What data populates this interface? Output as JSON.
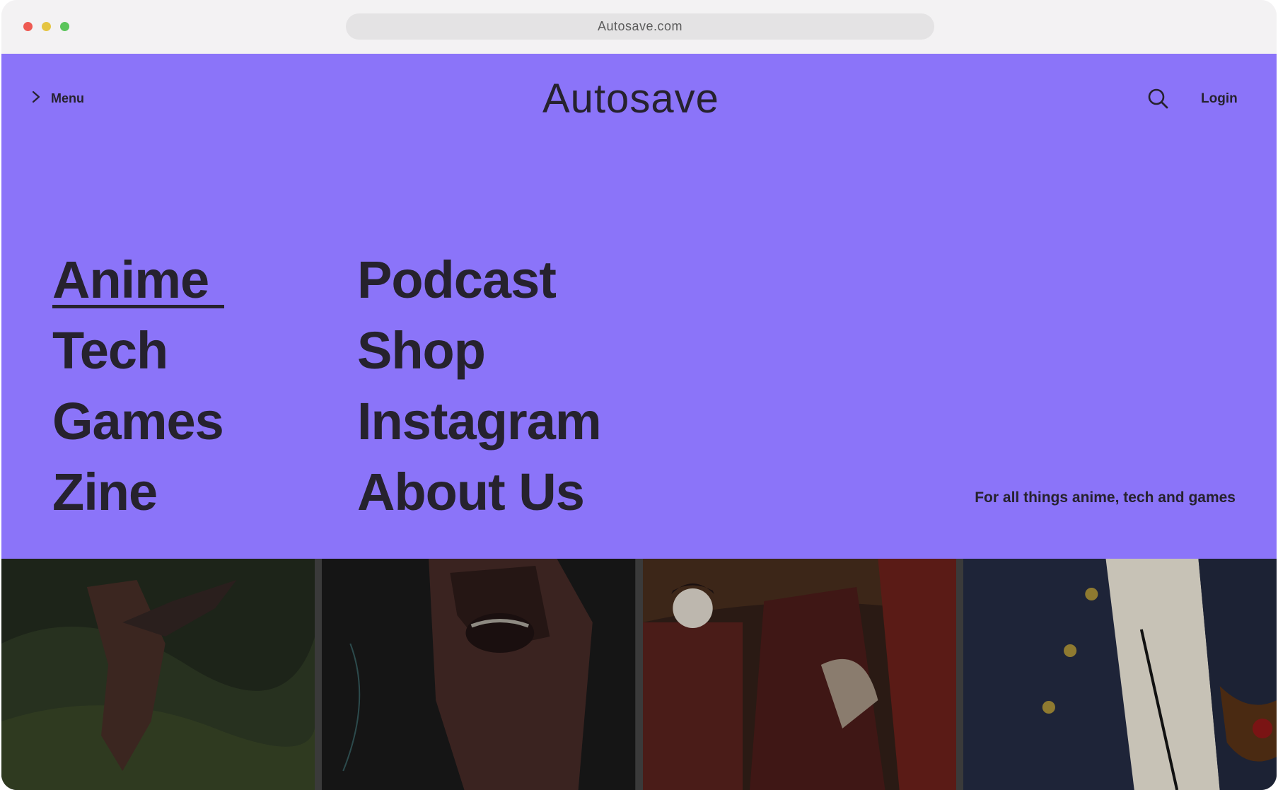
{
  "browser": {
    "url": "Autosave.com",
    "dots": [
      "#ee5a52",
      "#e5c542",
      "#5bc55b"
    ]
  },
  "colors": {
    "hero_bg": "#8b74f9",
    "text": "#26222e"
  },
  "header": {
    "menu_icon": "chevron-right-icon",
    "menu_label": "Menu",
    "logo": "Autosave",
    "search_icon": "search-icon",
    "login_label": "Login"
  },
  "nav": {
    "left": [
      "Anime",
      "Tech",
      "Games",
      "Zine"
    ],
    "right": [
      "Podcast",
      "Shop",
      "Instagram",
      "About Us"
    ],
    "active": "Anime"
  },
  "tagline": "For all things anime, tech and games",
  "gallery": {
    "panels": [
      "anime-scene-1",
      "anime-scene-2",
      "anime-scene-3",
      "anime-scene-4"
    ]
  }
}
